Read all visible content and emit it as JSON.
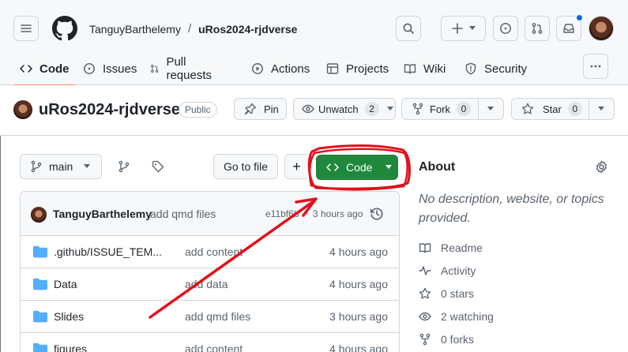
{
  "header": {
    "owner": "TanguyBarthelemy",
    "separator": "/",
    "repo": "uRos2024-rjdverse"
  },
  "tabs": [
    {
      "label": "Code",
      "icon": "code-icon"
    },
    {
      "label": "Issues",
      "icon": "issue-icon"
    },
    {
      "label": "Pull requests",
      "icon": "pull-request-icon"
    },
    {
      "label": "Actions",
      "icon": "play-icon"
    },
    {
      "label": "Projects",
      "icon": "table-icon"
    },
    {
      "label": "Wiki",
      "icon": "book-icon"
    },
    {
      "label": "Security",
      "icon": "shield-icon"
    }
  ],
  "repohead": {
    "name": "uRos2024-rjdverse",
    "visibility": "Public",
    "pin_label": "Pin",
    "watch_label": "Unwatch",
    "watch_count": "2",
    "fork_label": "Fork",
    "fork_count": "0",
    "star_label": "Star",
    "star_count": "0"
  },
  "toolbar": {
    "branch": "main",
    "goto_label": "Go to file",
    "add_label": "+",
    "code_label": "Code"
  },
  "commit": {
    "author": "TanguyBarthelemy",
    "message": "add qmd files",
    "sha": "e11bf6b",
    "age": "3 hours ago"
  },
  "files": [
    {
      "name": ".github/ISSUE_TEM...",
      "message": "add content",
      "age": "4 hours ago"
    },
    {
      "name": "Data",
      "message": "add data",
      "age": "4 hours ago"
    },
    {
      "name": "Slides",
      "message": "add qmd files",
      "age": "3 hours ago"
    },
    {
      "name": "figures",
      "message": "add content",
      "age": "4 hours ago"
    }
  ],
  "about": {
    "title": "About",
    "description": "No description, website, or topics provided.",
    "items": [
      {
        "icon": "book-icon",
        "label": "Readme"
      },
      {
        "icon": "pulse-icon",
        "label": "Activity"
      },
      {
        "icon": "star-icon",
        "label": "0 stars"
      },
      {
        "icon": "eye-icon",
        "label": "2 watching"
      },
      {
        "icon": "fork-icon",
        "label": "0 forks"
      }
    ]
  },
  "colors": {
    "accent_green": "#1f883d",
    "annotation_red": "#e0111b",
    "tab_underline": "#fd8c73",
    "notification_dot": "#0969da"
  }
}
